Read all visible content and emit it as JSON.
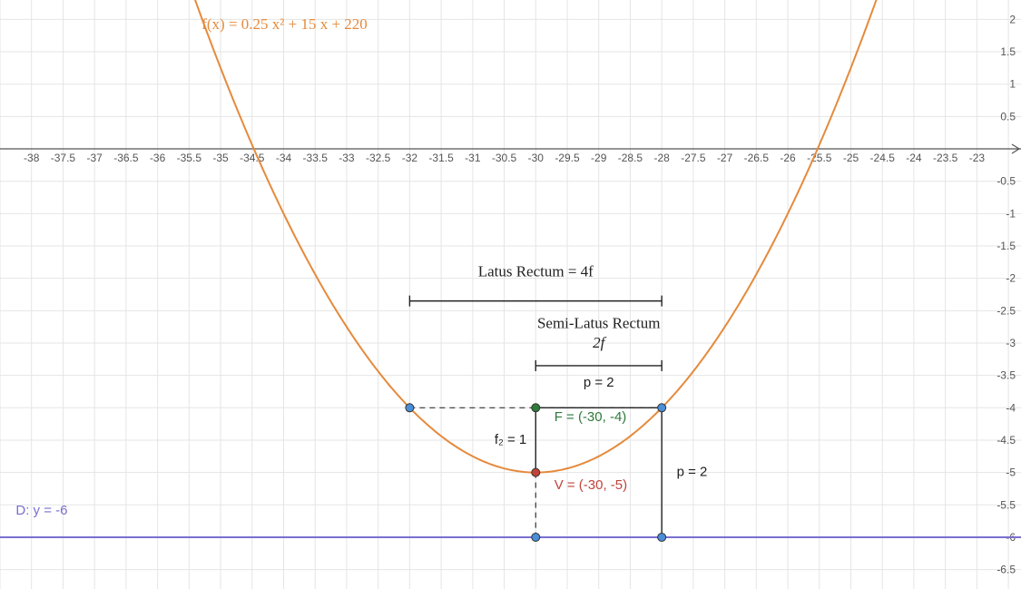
{
  "chart_data": {
    "type": "line",
    "title": "",
    "xlabel": "",
    "ylabel": "",
    "xlim": [
      -38.5,
      -22.3
    ],
    "ylim": [
      -6.8,
      2.3
    ],
    "xstep": 0.5,
    "ystep": 0.5,
    "series": [
      {
        "name": "f(x) = 0.25x^2 + 15x + 220",
        "type": "parabola",
        "coefficients": {
          "a": 0.25,
          "b": 15,
          "c": 220
        },
        "color": "#e58a3c"
      },
      {
        "name": "Directrix D: y = -6",
        "type": "hline",
        "y": -6,
        "color": "#7a6fd0"
      }
    ],
    "points": {
      "V": {
        "x": -30,
        "y": -5,
        "label": "V = (-30, -5)",
        "color": "red"
      },
      "F": {
        "x": -30,
        "y": -4,
        "label": "F = (-30, -4)",
        "color": "green"
      },
      "L1": {
        "x": -32,
        "y": -4,
        "color": "blue"
      },
      "L2": {
        "x": -28,
        "y": -4,
        "color": "blue"
      },
      "D1": {
        "x": -30,
        "y": -6,
        "color": "blue"
      },
      "D2": {
        "x": -28,
        "y": -6,
        "color": "blue"
      }
    },
    "segments": [
      {
        "from": "L1",
        "to": "L2",
        "style": "dashed"
      },
      {
        "from": "V",
        "to": "D1",
        "style": "dashed"
      },
      {
        "from": "F",
        "to": "V",
        "style": "solid"
      },
      {
        "from": "F",
        "to": "L2",
        "style": "solid"
      },
      {
        "from": "L2",
        "to": "D2",
        "style": "solid"
      }
    ],
    "annotations": {
      "function_label": "f(x)  =  0.25 x² + 15 x + 220",
      "directrix_label": "D: y = -6",
      "latus_rectum": "Latus Rectum = 4f",
      "semi_latus_rectum_line1": "Semi-Latus Rectum",
      "semi_latus_rectum_line2": "2f",
      "p_top": "p = 2",
      "p_side": "p = 2",
      "f2": "f₂ = 1"
    },
    "brackets": {
      "latus": {
        "x1": -32,
        "x2": -28,
        "y": -2.35
      },
      "semi_latus": {
        "x1": -30,
        "x2": -28,
        "y": -3.35
      }
    }
  },
  "colors": {
    "curve": "#e58a3c",
    "directrix": "#7a6fd0",
    "vertex": "#c0443a",
    "focus": "#2f7a3a",
    "point": "#4a8ed8"
  }
}
